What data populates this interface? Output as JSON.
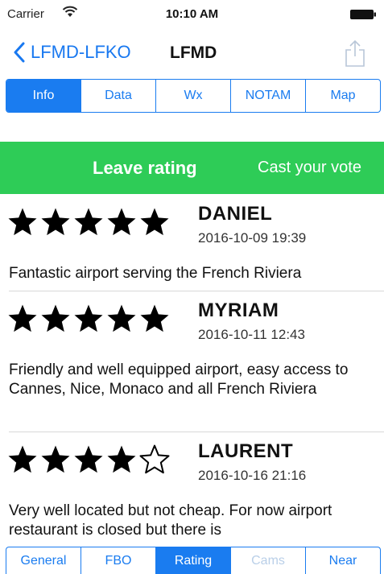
{
  "status": {
    "carrier": "Carrier",
    "time": "10:10 AM"
  },
  "nav": {
    "back_label": "LFMD-LFKO",
    "title": "LFMD"
  },
  "top_tabs": [
    {
      "label": "Info",
      "active": true
    },
    {
      "label": "Data",
      "active": false
    },
    {
      "label": "Wx",
      "active": false
    },
    {
      "label": "NOTAM",
      "active": false
    },
    {
      "label": "Map",
      "active": false
    }
  ],
  "banner": {
    "leave_label": "Leave rating",
    "cast_label": "Cast your vote",
    "color": "#2ecc57"
  },
  "reviews": [
    {
      "name": "DANIEL",
      "date": "2016-10-09 19:39",
      "rating": 5,
      "comment": "Fantastic airport serving the French Riviera"
    },
    {
      "name": "MYRIAM",
      "date": "2016-10-11 12:43",
      "rating": 5,
      "comment": "Friendly and well equipped airport, easy access to Cannes, Nice, Monaco and all French Riviera"
    },
    {
      "name": "LAURENT",
      "date": "2016-10-16 21:16",
      "rating": 4,
      "comment": "Very well located but not cheap. For now airport restaurant is closed but there is"
    }
  ],
  "bottom_tabs": [
    {
      "label": "General",
      "active": false,
      "disabled": false
    },
    {
      "label": "FBO",
      "active": false,
      "disabled": false
    },
    {
      "label": "Rating",
      "active": true,
      "disabled": false
    },
    {
      "label": "Cams",
      "active": false,
      "disabled": true
    },
    {
      "label": "Near",
      "active": false,
      "disabled": false
    }
  ],
  "colors": {
    "accent": "#1a7cf0",
    "banner": "#2ecc57"
  }
}
